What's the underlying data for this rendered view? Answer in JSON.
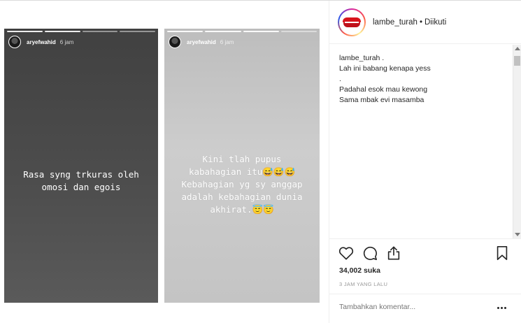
{
  "post": {
    "stories": [
      {
        "username": "aryefwahid",
        "time": "6 jam",
        "text": "Rasa syng trkuras oleh\nomosi dan egois"
      },
      {
        "username": "aryefwahid",
        "time": "6 jam",
        "text": "Kini tlah pupus\nkabahagian itu😅😅😅\nKebahagian yg sy anggap\nadalah kebahagian dunia\nakhirat.😇😇"
      }
    ]
  },
  "header": {
    "username": "lambe_turah",
    "separator": "•",
    "follow_status": "Diikuti",
    "avatar_icon": "lips-logo-icon"
  },
  "caption": {
    "author": "lambe_turah .",
    "lines": [
      "Lah ini babang kenapa yess",
      ".",
      "Padahal esok mau kewong",
      "Sama mbak evi masamba"
    ]
  },
  "actions": {
    "like_icon": "heart-icon",
    "comment_icon": "comment-bubble-icon",
    "share_icon": "share-icon",
    "save_icon": "bookmark-icon"
  },
  "likes": "34,002 suka",
  "timestamp": "3 JAM YANG LALU",
  "comment_input": {
    "placeholder": "Tambahkan komentar..."
  },
  "colors": {
    "text": "#262626",
    "muted": "#999999",
    "lips_red": "#d8141c"
  }
}
